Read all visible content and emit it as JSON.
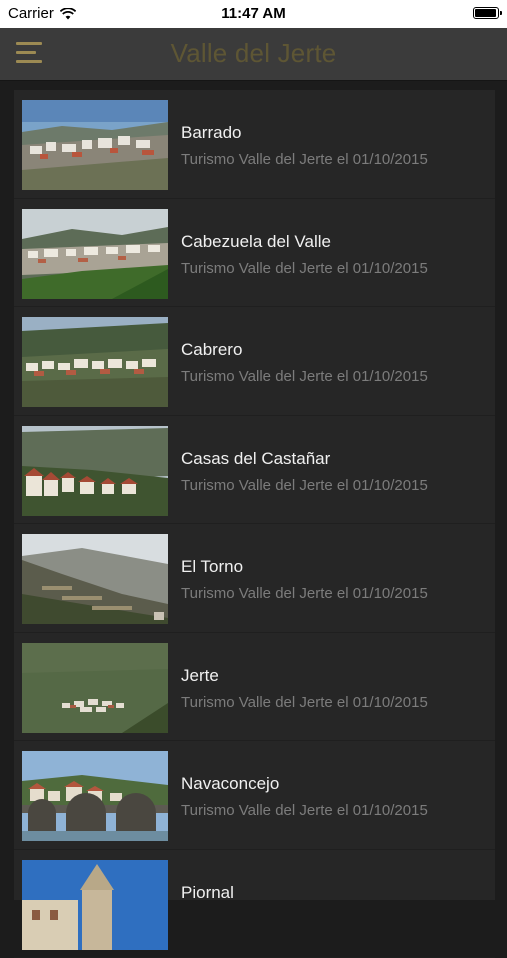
{
  "status_bar": {
    "carrier": "Carrier",
    "time": "11:47 AM",
    "battery_level": 1.0,
    "wifi_icon": "wifi-icon"
  },
  "nav_bar": {
    "title": "Valle del Jerte",
    "menu_icon": "hamburger-menu-icon",
    "accent_color": "#9c8a53"
  },
  "list": {
    "items": [
      {
        "title": "Barrado",
        "subtitle": "Turismo Valle del Jerte el 01/10/2015"
      },
      {
        "title": "Cabezuela del Valle",
        "subtitle": "Turismo Valle del Jerte el 01/10/2015"
      },
      {
        "title": "Cabrero",
        "subtitle": "Turismo Valle del Jerte el 01/10/2015"
      },
      {
        "title": "Casas del Castañar",
        "subtitle": "Turismo Valle del Jerte el 01/10/2015"
      },
      {
        "title": "El Torno",
        "subtitle": "Turismo Valle del Jerte el 01/10/2015"
      },
      {
        "title": "Jerte",
        "subtitle": "Turismo Valle del Jerte el 01/10/2015"
      },
      {
        "title": "Navaconcejo",
        "subtitle": "Turismo Valle del Jerte el 01/10/2015"
      },
      {
        "title": "Piornal",
        "subtitle": ""
      }
    ]
  }
}
